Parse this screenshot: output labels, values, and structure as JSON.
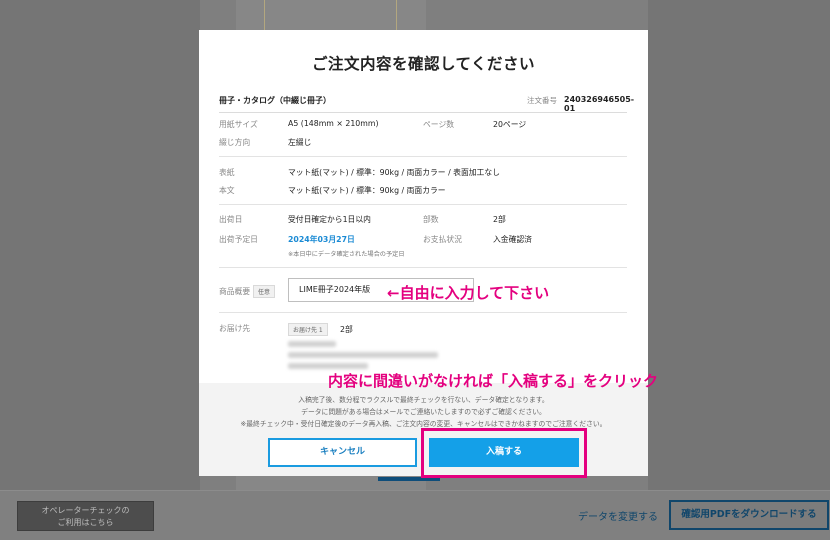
{
  "modal": {
    "title": "ご注文内容を確認してください",
    "product": "冊子・カタログ（中綴じ冊子）",
    "order_label": "注文番号",
    "order_no": "240326946505-01",
    "paper_size_label": "用紙サイズ",
    "paper_size": "A5 (148mm × 210mm)",
    "pages_label": "ページ数",
    "pages": "20ページ",
    "binding_label": "綴じ方向",
    "binding": "左綴じ",
    "cover_label": "表紙",
    "cover": "マット紙(マット) / 標準：90kg / 両面カラー / 表面加工なし",
    "body_label": "本文",
    "body": "マット紙(マット) / 標準：90kg / 両面カラー",
    "ship_label": "出荷日",
    "ship": "受付日確定から1日以内",
    "copies_label": "部数",
    "copies": "2部",
    "ship_planned_label": "出荷予定日",
    "ship_planned": "2024年03月27日",
    "ship_note": "※本日中にデータ確定された場合の予定日",
    "payment_label": "お支払状況",
    "payment": "入金確認済",
    "item_name_label": "商品概要",
    "item_name_tag": "任意",
    "item_name_value": "LIME冊子2024年版",
    "delivery_label": "お届け先",
    "delivery_tag": "お届け先 1",
    "delivery_copies": "2部",
    "info_line1": "入稿完了後、数分程でラクスルで最終チェックを行ない、データ確定となります。",
    "info_line2": "データに問題がある場合はメールでご連絡いたしますので必ずご確認ください。",
    "info_line3": "※最終チェック中・受付日確定後のデータ再入稿、ご注文内容の変更、キャンセルはできかねますのでご注意ください。",
    "cancel_label": "キャンセル",
    "submit_label": "入稿する"
  },
  "background": {
    "operator_check": "オペレーターチェックの",
    "operator_check2": "ご利用はこちら",
    "change_data": "データを変更する",
    "download_pdf": "確認用PDFをダウンロードする"
  },
  "annotations": {
    "input_hint": "←自由に入力して下さい",
    "submit_hint": "内容に間違いがなければ「入稿する」をクリック"
  },
  "colors": {
    "accent": "#14a0e8",
    "annotation": "#e4007f",
    "navy": "#10466b"
  }
}
